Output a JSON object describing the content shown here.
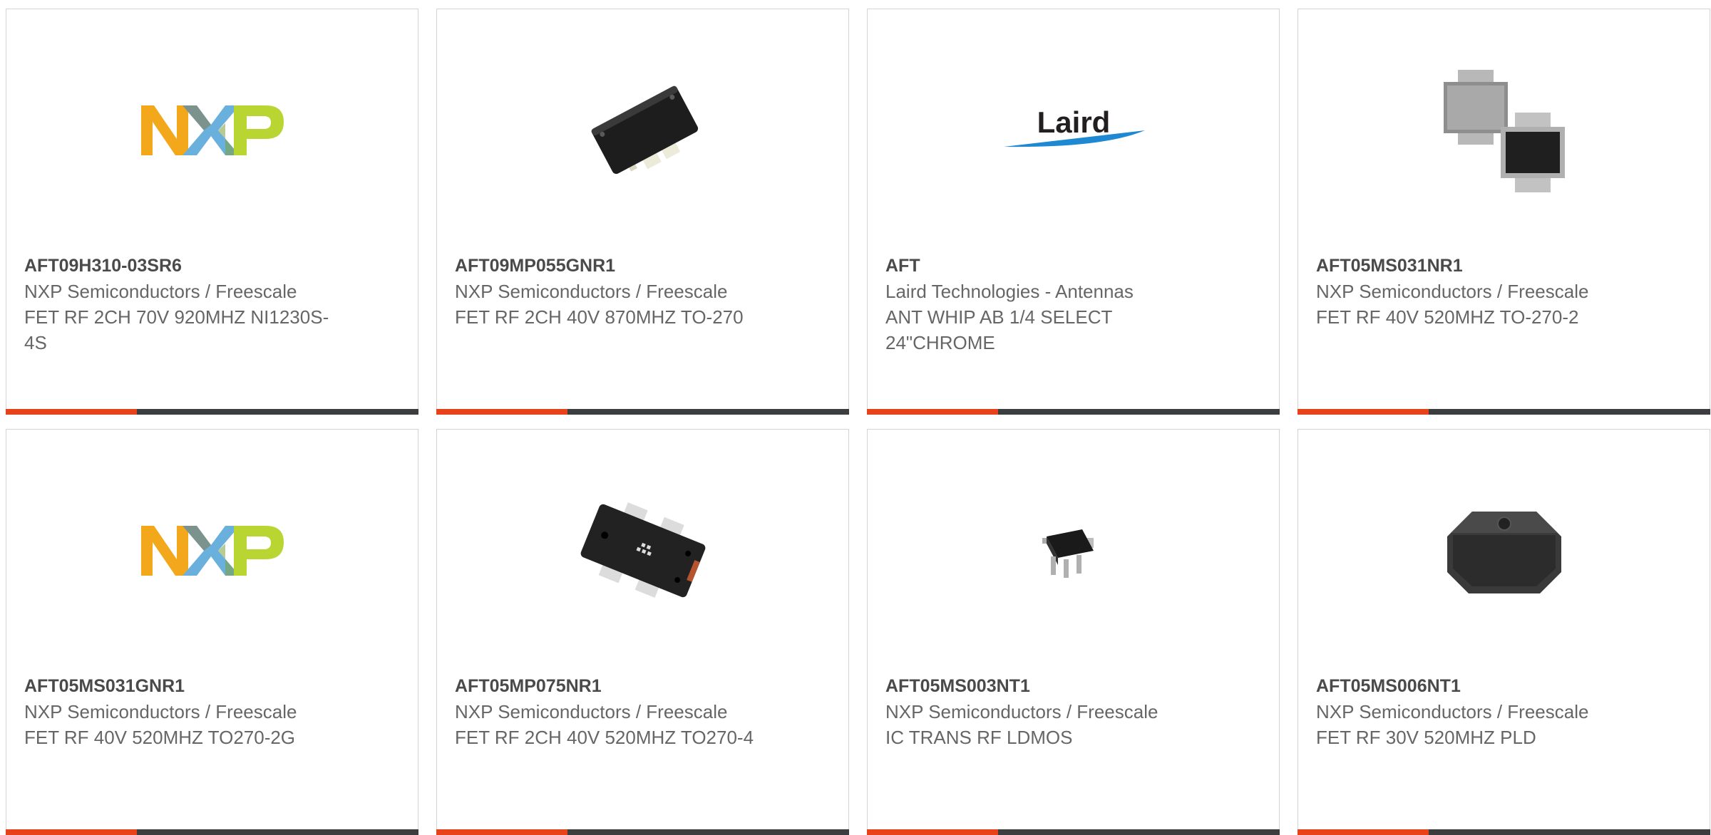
{
  "products": [
    {
      "part_number": "AFT09H310-03SR6",
      "manufacturer": "NXP Semiconductors / Freescale",
      "description": "FET RF 2CH 70V 920MHZ NI1230S-4S",
      "image": "nxp-logo"
    },
    {
      "part_number": "AFT09MP055GNR1",
      "manufacturer": "NXP Semiconductors / Freescale",
      "description": "FET RF 2CH 40V 870MHZ TO-270",
      "image": "rf-package-black-image"
    },
    {
      "part_number": "AFT",
      "manufacturer": "Laird Technologies - Antennas",
      "description": "ANT WHIP AB 1/4 SELECT 24\"CHROME",
      "image": "laird-logo",
      "logo_text": "Laird"
    },
    {
      "part_number": "AFT05MS031NR1",
      "manufacturer": "NXP Semiconductors / Freescale",
      "description": "FET RF 40V 520MHZ TO-270-2",
      "image": "to270-packages-image"
    },
    {
      "part_number": "AFT05MS031GNR1",
      "manufacturer": "NXP Semiconductors / Freescale",
      "description": "FET RF 40V 520MHZ TO270-2G",
      "image": "nxp-logo"
    },
    {
      "part_number": "AFT05MP075NR1",
      "manufacturer": "NXP Semiconductors / Freescale",
      "description": "FET RF 2CH 40V 520MHZ TO270-4",
      "image": "to270-4-package-image"
    },
    {
      "part_number": "AFT05MS003NT1",
      "manufacturer": "NXP Semiconductors / Freescale",
      "description": "IC TRANS RF LDMOS",
      "image": "sot89-transistor-image"
    },
    {
      "part_number": "AFT05MS006NT1",
      "manufacturer": "NXP Semiconductors / Freescale",
      "description": "FET RF 30V 520MHZ PLD",
      "image": "pld-package-image"
    }
  ],
  "colors": {
    "accent": "#e8421a",
    "bar": "#3b3d3f",
    "border": "#d4d4d4",
    "part_number_text": "#4a4a4a",
    "body_text": "#666666",
    "nxp_orange": "#f3a81c",
    "nxp_blue": "#6ab0dd",
    "nxp_green": "#b9d531",
    "laird_text": "#231f20",
    "laird_swoosh": "#1e88d2"
  }
}
